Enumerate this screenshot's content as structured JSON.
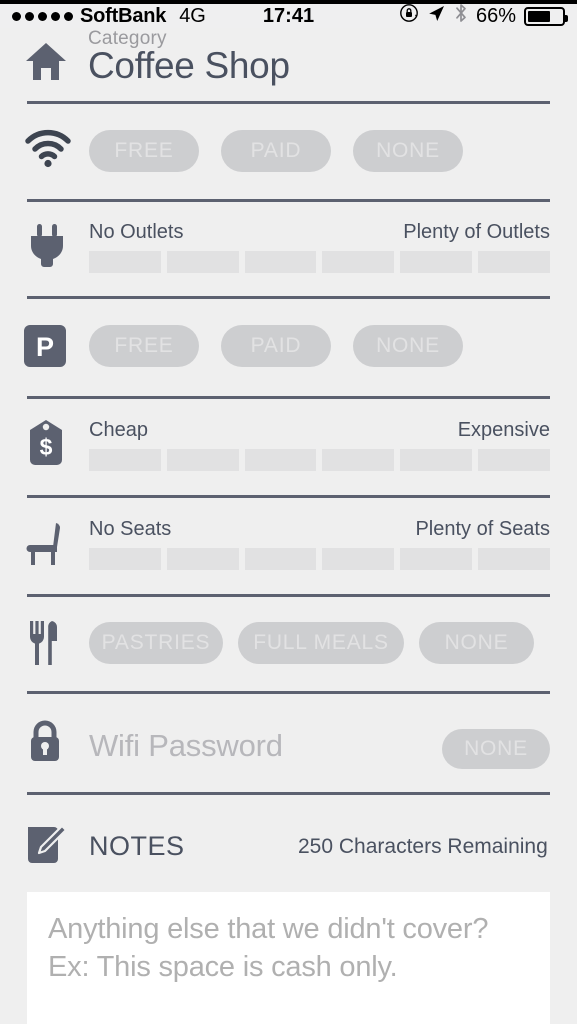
{
  "statusbar": {
    "signal_dots": 5,
    "carrier": "SoftBank",
    "network": "4G",
    "time": "17:41",
    "battery_percent": "66%",
    "battery_level": 66,
    "icons": [
      "rotation-lock-icon",
      "location-arrow-icon",
      "bluetooth-icon"
    ]
  },
  "header": {
    "icon": "home-icon",
    "category_label": "Category",
    "title": "Coffee Shop"
  },
  "rows": {
    "wifi": {
      "icon": "wifi-icon",
      "options": [
        "FREE",
        "PAID",
        "NONE"
      ]
    },
    "outlets": {
      "icon": "power-plug-icon",
      "left_label": "No Outlets",
      "right_label": "Plenty of Outlets",
      "segments": 6,
      "selected": null
    },
    "parking": {
      "icon": "parking-icon",
      "icon_glyph": "P",
      "options": [
        "FREE",
        "PAID",
        "NONE"
      ]
    },
    "price": {
      "icon": "price-tag-icon",
      "icon_glyph": "$",
      "left_label": "Cheap",
      "right_label": "Expensive",
      "segments": 6,
      "selected": null
    },
    "seats": {
      "icon": "chair-icon",
      "left_label": "No Seats",
      "right_label": "Plenty of Seats",
      "segments": 6,
      "selected": null
    },
    "food": {
      "icon": "fork-knife-icon",
      "options": [
        "PASTRIES",
        "FULL MEALS",
        "NONE"
      ]
    },
    "wifi_password": {
      "icon": "lock-icon",
      "placeholder": "Wifi Password",
      "value": "",
      "none_label": "NONE"
    },
    "notes": {
      "icon": "notes-pencil-icon",
      "title": "NOTES",
      "counter": "250 Characters Remaining",
      "placeholder": "Anything else that we didn't cover? Ex: This space is cash only.",
      "value": ""
    }
  },
  "colors": {
    "background": "#efefef",
    "separator": "#5c6170",
    "pill_bg": "#cdced0",
    "pill_text": "#e2e2e3",
    "segment_bg": "#e1e1e2",
    "text_dark": "#4a5160",
    "text_muted": "#b7b7bb",
    "icon_dark": "#5c6170",
    "notes_bg": "#ffffff"
  }
}
